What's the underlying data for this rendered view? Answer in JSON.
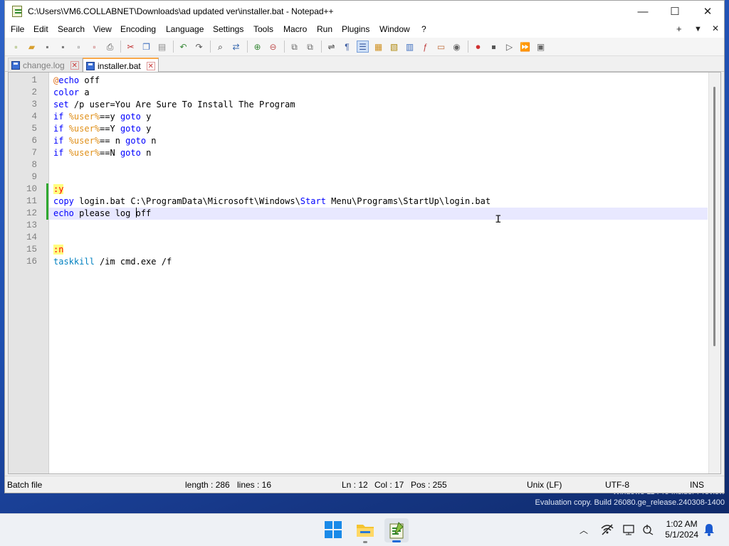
{
  "window": {
    "title": "C:\\Users\\VM6.COLLABNET\\Downloads\\ad updated ver\\installer.bat - Notepad++",
    "controls": {
      "minimize": "—",
      "maximize": "☐",
      "close": "✕"
    }
  },
  "menu": {
    "items": [
      "File",
      "Edit",
      "Search",
      "View",
      "Encoding",
      "Language",
      "Settings",
      "Tools",
      "Macro",
      "Run",
      "Plugins",
      "Window",
      "?"
    ],
    "right": [
      "+",
      "▼",
      "✕"
    ]
  },
  "toolbar": {
    "icons": [
      "new-file-icon",
      "open-file-icon",
      "save-icon",
      "save-all-icon",
      "close-icon",
      "close-all-icon",
      "print-icon",
      "cut-icon",
      "copy-icon",
      "paste-icon",
      "undo-icon",
      "redo-icon",
      "find-icon",
      "replace-icon",
      "zoom-in-icon",
      "zoom-out-icon",
      "sync-vertical-icon",
      "sync-horizontal-icon",
      "word-wrap-icon",
      "show-all-chars-icon",
      "indent-guide-icon",
      "user-language-icon",
      "document-map-icon",
      "function-list-icon",
      "folder-workspace-icon",
      "document-list-icon",
      "monitoring-icon",
      "record-macro-icon",
      "stop-record-icon",
      "playback-macro-icon",
      "run-macro-multiple-icon",
      "save-macro-icon"
    ]
  },
  "tabs": [
    {
      "label": "change.log",
      "active": false,
      "close": "✕"
    },
    {
      "label": "installer.bat",
      "active": true,
      "close": "✕"
    }
  ],
  "editor": {
    "line_numbers": [
      "1",
      "2",
      "3",
      "4",
      "5",
      "6",
      "7",
      "8",
      "9",
      "10",
      "11",
      "12",
      "13",
      "14",
      "15",
      "16"
    ],
    "current_line": 12,
    "lines": [
      [
        {
          "t": "@",
          "c": "at"
        },
        {
          "t": "echo",
          "c": "kw"
        },
        {
          "t": " off",
          "c": ""
        }
      ],
      [
        {
          "t": "color",
          "c": "kw"
        },
        {
          "t": " a",
          "c": ""
        }
      ],
      [
        {
          "t": "set",
          "c": "kw"
        },
        {
          "t": " /p user=You Are Sure To Install The Program",
          "c": ""
        }
      ],
      [
        {
          "t": "if",
          "c": "kw"
        },
        {
          "t": " ",
          "c": ""
        },
        {
          "t": "%user%",
          "c": "var"
        },
        {
          "t": "==y ",
          "c": ""
        },
        {
          "t": "goto",
          "c": "kw"
        },
        {
          "t": " y",
          "c": ""
        }
      ],
      [
        {
          "t": "if",
          "c": "kw"
        },
        {
          "t": " ",
          "c": ""
        },
        {
          "t": "%user%",
          "c": "var"
        },
        {
          "t": "==Y ",
          "c": ""
        },
        {
          "t": "goto",
          "c": "kw"
        },
        {
          "t": " y",
          "c": ""
        }
      ],
      [
        {
          "t": "if",
          "c": "kw"
        },
        {
          "t": " ",
          "c": ""
        },
        {
          "t": "%user%",
          "c": "var"
        },
        {
          "t": "== n ",
          "c": ""
        },
        {
          "t": "goto",
          "c": "kw"
        },
        {
          "t": " n",
          "c": ""
        }
      ],
      [
        {
          "t": "if",
          "c": "kw"
        },
        {
          "t": " ",
          "c": ""
        },
        {
          "t": "%user%",
          "c": "var"
        },
        {
          "t": "==N ",
          "c": ""
        },
        {
          "t": "goto",
          "c": "kw"
        },
        {
          "t": " n",
          "c": ""
        }
      ],
      [],
      [],
      [
        {
          "t": ":y",
          "c": "lbl"
        }
      ],
      [
        {
          "t": "copy",
          "c": "kw"
        },
        {
          "t": " login.bat C:\\ProgramData\\Microsoft\\Windows\\",
          "c": ""
        },
        {
          "t": "Start",
          "c": "kw"
        },
        {
          "t": " Menu\\Programs\\StartUp\\login.bat",
          "c": ""
        }
      ],
      [
        {
          "t": "echo",
          "c": "kw"
        },
        {
          "t": " please log ",
          "c": ""
        },
        {
          "t": "|",
          "c": "caret"
        },
        {
          "t": "off",
          "c": ""
        }
      ],
      [],
      [],
      [
        {
          "t": ":n",
          "c": "lbl"
        }
      ],
      [
        {
          "t": "taskkill",
          "c": "cmd"
        },
        {
          "t": " /im cmd.exe /f",
          "c": ""
        }
      ]
    ]
  },
  "status": {
    "file_type": "Batch file",
    "length": "length : 286",
    "lines": "lines : 16",
    "ln": "Ln : 12",
    "col": "Col : 17",
    "pos": "Pos : 255",
    "eol": "Unix (LF)",
    "encoding": "UTF-8",
    "mode": "INS"
  },
  "desktop": {
    "watermark_line1": "Windows 11 Pro Insider Preview",
    "watermark_line2": "Evaluation copy. Build 26080.ge_release.240308-1400"
  },
  "taskbar": {
    "apps": [
      "start-icon",
      "file-explorer-icon",
      "notepadpp-icon"
    ],
    "tray": [
      "chevron-up-icon",
      "network-icon",
      "display-icon",
      "power-icon"
    ],
    "time": "1:02 AM",
    "date": "5/1/2024",
    "notification": "bell-icon"
  },
  "colors": {
    "keyword": "#0000ff",
    "variable": "#e0901a",
    "label_fg": "#ff0000",
    "label_bg": "#ffff80",
    "command": "#0080c0",
    "current_line": "#e8e8ff",
    "change_marker": "#2fa830"
  }
}
